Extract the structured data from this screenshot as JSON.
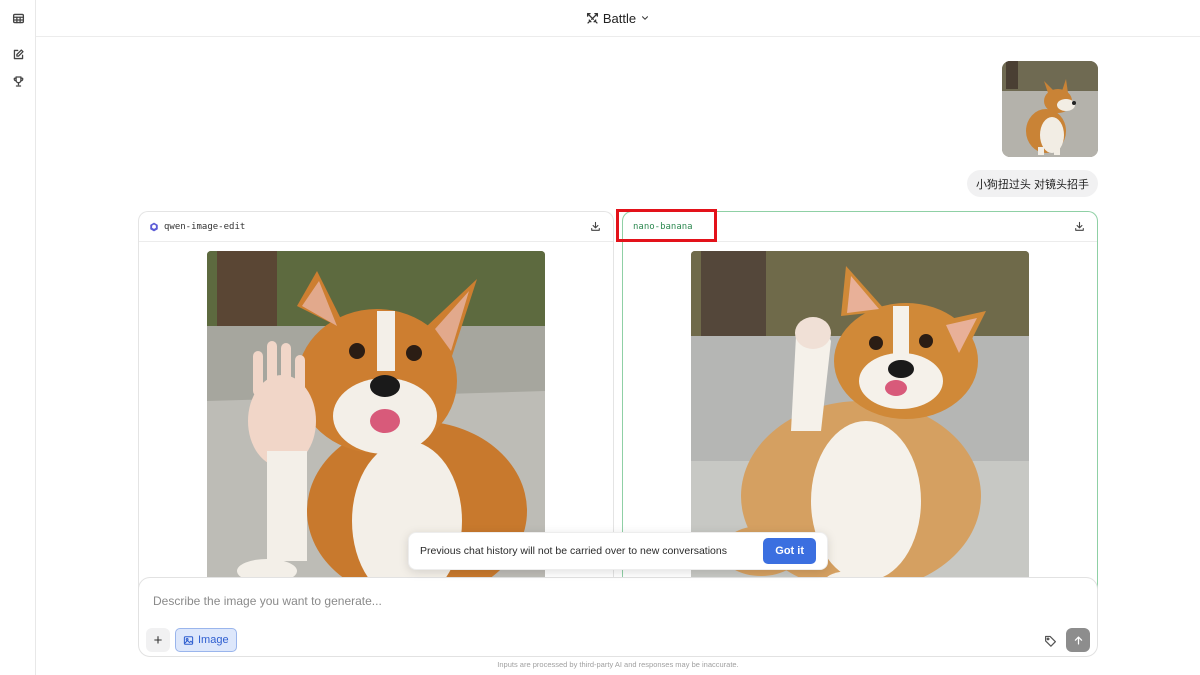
{
  "sidebar": {
    "items": [
      {
        "icon": "table-icon"
      },
      {
        "icon": "new-chat-icon"
      },
      {
        "icon": "trophy-icon"
      }
    ]
  },
  "header": {
    "mode_label": "Battle",
    "mode_icon": "swords-icon"
  },
  "conversation": {
    "user_message": "小狗扭过头 对镜头招手",
    "user_image": "corgi-photo"
  },
  "battle": {
    "left": {
      "model": "qwen-image-edit",
      "download_icon": "download-icon"
    },
    "right": {
      "model": "nano-banana",
      "download_icon": "download-icon"
    }
  },
  "toast": {
    "message": "Previous chat history will not be carried over to new conversations",
    "button": "Got it"
  },
  "composer": {
    "placeholder": "Describe the image you want to generate...",
    "plus_label": "+",
    "image_toggle_label": "Image"
  },
  "footer": {
    "disclaimer": "Inputs are processed by third-party AI and responses may be inaccurate."
  },
  "colors": {
    "accent": "#3b6fe0",
    "winner_border": "#8fd0a5",
    "highlight": "#e3121a"
  }
}
